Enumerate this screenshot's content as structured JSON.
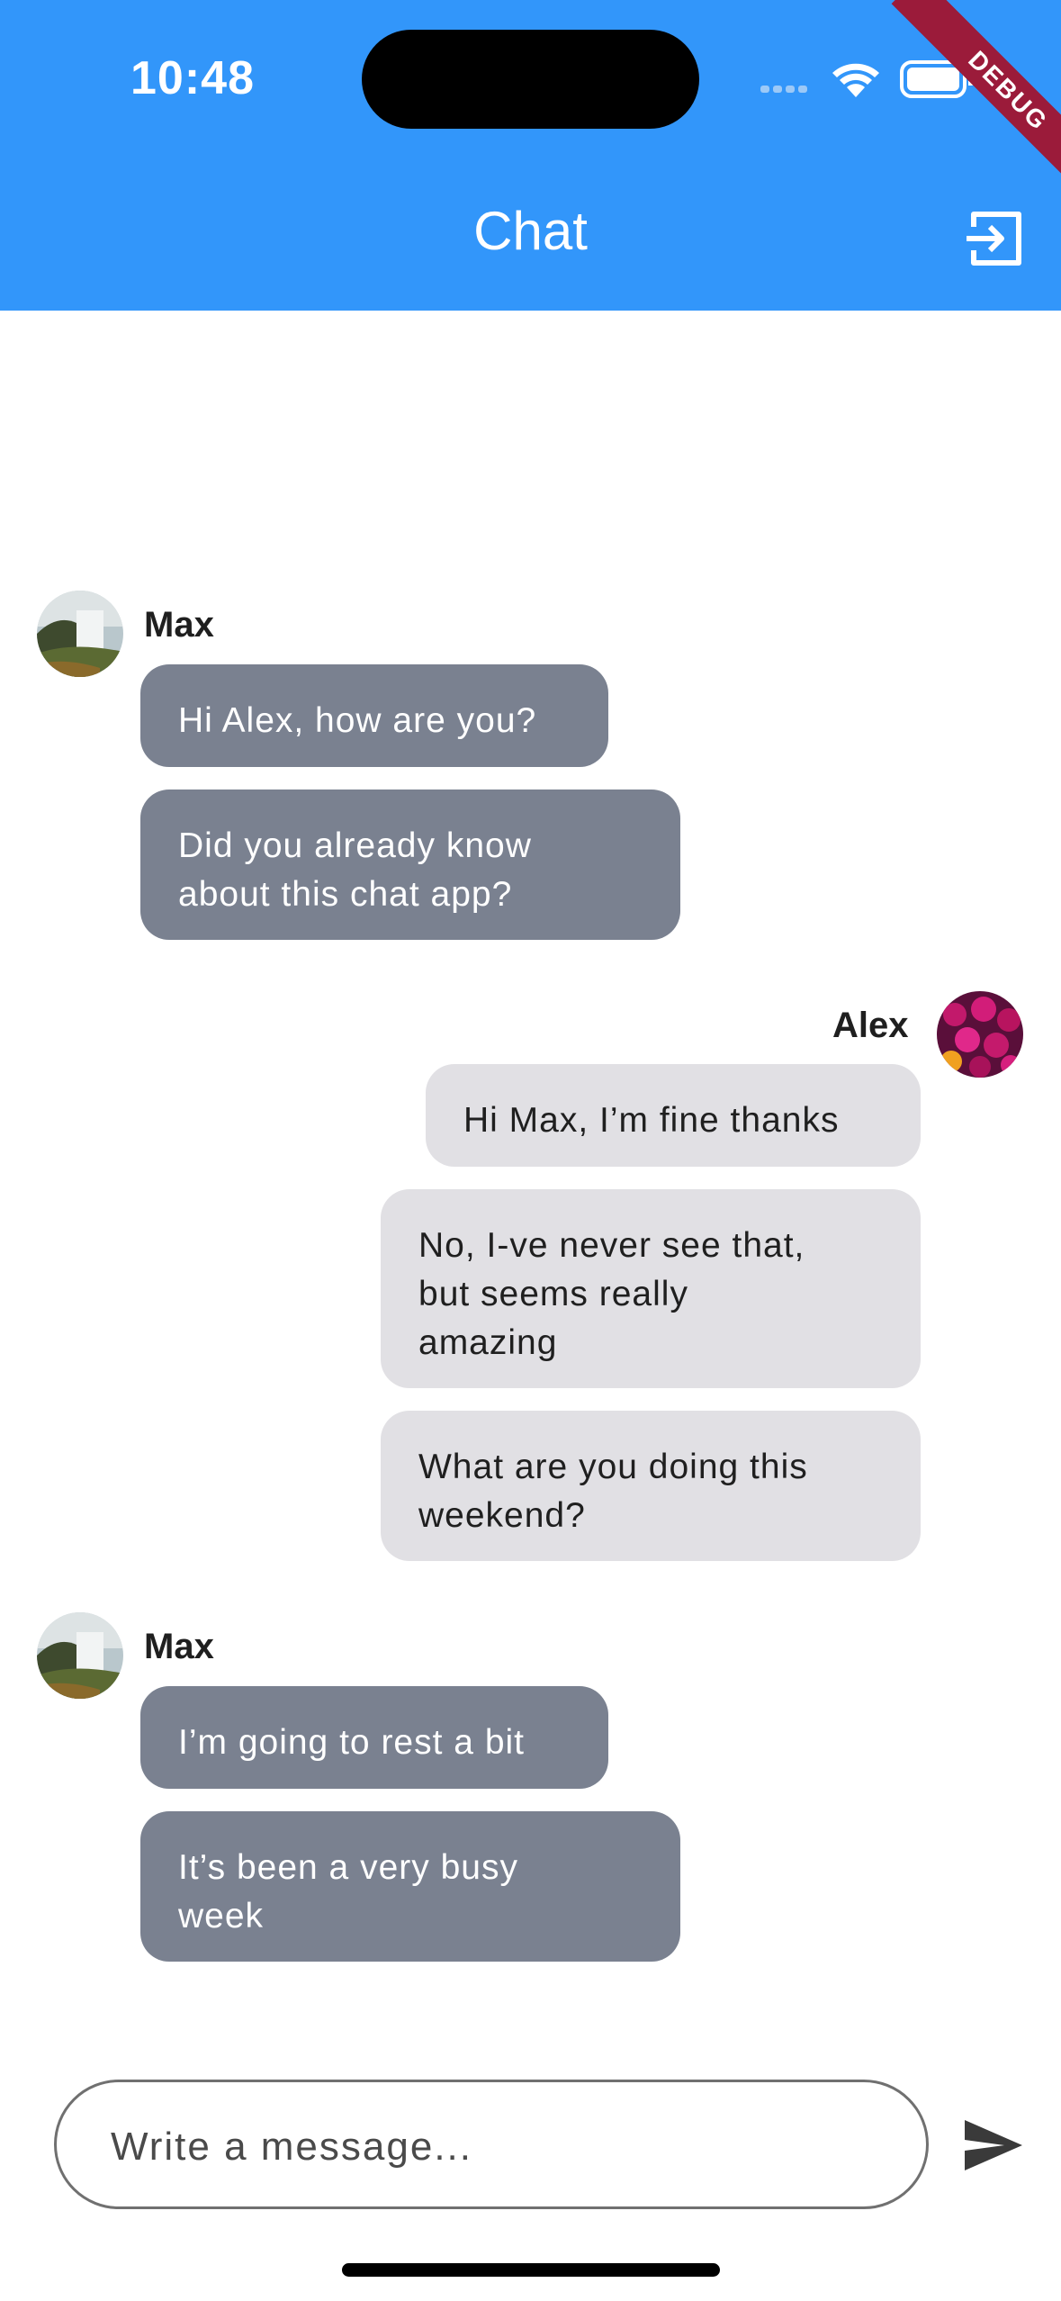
{
  "status_bar": {
    "time": "10:48",
    "debug_label": "DEBUG"
  },
  "app_bar": {
    "title": "Chat",
    "action_icon": "logout-icon"
  },
  "colors": {
    "app_bar": "#3296fa",
    "incoming_bubble": "#7a8190",
    "outgoing_bubble": "#e1e0e4"
  },
  "messages": [
    {
      "author": "Max",
      "direction": "incoming",
      "avatar_icon": "waterfall-avatar",
      "bubbles": [
        {
          "lines": [
            "Hi Alex, how are you?"
          ]
        },
        {
          "lines": [
            "Did you already know",
            "about this chat app?"
          ]
        }
      ]
    },
    {
      "author": "Alex",
      "direction": "outgoing",
      "avatar_icon": "flowers-avatar",
      "bubbles": [
        {
          "lines": [
            "Hi Max, I’m fine thanks"
          ]
        },
        {
          "lines": [
            "No, I-ve never see that,",
            "but seems really",
            "amazing"
          ]
        },
        {
          "lines": [
            "What are you doing this",
            "weekend?"
          ]
        }
      ]
    },
    {
      "author": "Max",
      "direction": "incoming",
      "avatar_icon": "waterfall-avatar",
      "bubbles": [
        {
          "lines": [
            "I’m going to rest a bit"
          ]
        },
        {
          "lines": [
            "It’s been a very busy",
            "week"
          ]
        }
      ]
    }
  ],
  "composer": {
    "placeholder": "Write a message...",
    "value": ""
  },
  "send_icon": "send-icon"
}
